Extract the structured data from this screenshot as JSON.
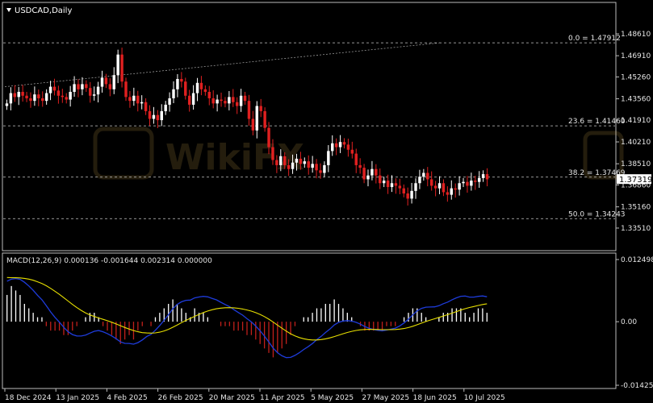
{
  "window": {
    "title": "USDCAD,Daily",
    "menu_icon": "triangle-down-icon",
    "watermark": "WikiFX"
  },
  "colors": {
    "background": "#000000",
    "bull_candle": "#ffffff",
    "bear_candle": "#e02020",
    "grid": "#ffffff",
    "fib_line": "#c8c8c8",
    "macd_pos_hist": "#ffffff",
    "macd_neg_hist": "#c0201b",
    "macd_main": "#1e3cdc",
    "macd_signal": "#e8e000",
    "price_box_bg": "#ffffff"
  },
  "price_axis": {
    "ticks": [
      "1.48610",
      "1.46910",
      "1.45260",
      "1.43560",
      "1.41910",
      "1.40210",
      "1.38510",
      "1.36860",
      "1.35160",
      "1.33510"
    ],
    "current_price": "1.37319"
  },
  "macd_axis": {
    "ticks": [
      "0.012498",
      "0.00",
      "-0.014259"
    ]
  },
  "time_axis": {
    "labels": [
      "18 Dec 2024",
      "13 Jan 2025",
      "4 Feb 2025",
      "26 Feb 2025",
      "20 Mar 2025",
      "11 Apr 2025",
      "5 May 2025",
      "27 May 2025",
      "18 Jun 2025",
      "10 Jul 2025"
    ]
  },
  "fibonacci": [
    {
      "label": "0.0 = 1.47912",
      "level": 1.47912
    },
    {
      "label": "23.6 = 1.41460",
      "level": 1.4146
    },
    {
      "label": "38.2 = 1.37469",
      "level": 1.37469
    },
    {
      "label": "50.0 = 1.34243",
      "level": 1.34243
    }
  ],
  "macd": {
    "label": "MACD(12,26,9) 0.000136 -0.001644 0.002314 0.000000"
  },
  "chart_data": {
    "type": "candlestick",
    "symbol": "USDCAD",
    "timeframe": "Daily",
    "y_range": [
      1.3351,
      1.4861
    ],
    "fib_anchor_levels": [
      1.47912,
      1.4146,
      1.37469,
      1.34243
    ],
    "close_path": [
      1.432,
      1.44,
      1.437,
      1.441,
      1.438,
      1.436,
      1.434,
      1.439,
      1.436,
      1.434,
      1.44,
      1.445,
      1.442,
      1.438,
      1.437,
      1.435,
      1.441,
      1.447,
      1.443,
      1.447,
      1.444,
      1.438,
      1.439,
      1.445,
      1.452,
      1.447,
      1.443,
      1.454,
      1.47,
      1.449,
      1.437,
      1.434,
      1.438,
      1.432,
      1.433,
      1.426,
      1.42,
      1.423,
      1.419,
      1.426,
      1.431,
      1.436,
      1.443,
      1.451,
      1.449,
      1.438,
      1.431,
      1.44,
      1.448,
      1.443,
      1.441,
      1.436,
      1.432,
      1.435,
      1.434,
      1.432,
      1.437,
      1.433,
      1.43,
      1.438,
      1.434,
      1.42,
      1.411,
      1.43,
      1.426,
      1.413,
      1.398,
      1.388,
      1.384,
      1.391,
      1.384,
      1.381,
      1.386,
      1.389,
      1.385,
      1.387,
      1.382,
      1.385,
      1.38,
      1.378,
      1.384,
      1.395,
      1.401,
      1.398,
      1.402,
      1.4,
      1.396,
      1.393,
      1.384,
      1.382,
      1.373,
      1.376,
      1.381,
      1.376,
      1.37,
      1.372,
      1.367,
      1.37,
      1.368,
      1.366,
      1.362,
      1.358,
      1.364,
      1.37,
      1.375,
      1.378,
      1.373,
      1.368,
      1.366,
      1.37,
      1.363,
      1.361,
      1.366,
      1.365,
      1.37,
      1.371,
      1.368,
      1.372,
      1.371,
      1.374,
      1.377,
      1.373
    ],
    "macd_histogram": [
      0.006,
      0.008,
      0.007,
      0.006,
      0.004,
      0.003,
      0.002,
      0.001,
      0.001,
      -0.001,
      -0.002,
      -0.002,
      -0.002,
      -0.003,
      -0.003,
      -0.002,
      -0.001,
      0.0,
      0.001,
      0.002,
      0.002,
      0.001,
      -0.001,
      -0.002,
      -0.003,
      -0.004,
      -0.005,
      -0.004,
      -0.003,
      -0.004,
      -0.002,
      -0.001,
      0.0,
      -0.001,
      0.001,
      0.002,
      0.003,
      0.004,
      0.005,
      0.004,
      0.003,
      0.002,
      0.001,
      0.003,
      0.002,
      0.002,
      0.001,
      0.0,
      0.0,
      -0.001,
      -0.001,
      -0.001,
      -0.002,
      -0.002,
      -0.002,
      -0.003,
      -0.003,
      -0.004,
      -0.005,
      -0.006,
      -0.007,
      -0.008,
      -0.007,
      -0.006,
      -0.005,
      -0.003,
      -0.001,
      0.0,
      0.001,
      0.001,
      0.002,
      0.003,
      0.003,
      0.004,
      0.004,
      0.005,
      0.004,
      0.003,
      0.002,
      0.001,
      0.0,
      -0.001,
      -0.002,
      -0.002,
      -0.002,
      -0.002,
      -0.002,
      -0.001,
      -0.001,
      -0.001,
      0.0,
      0.001,
      0.002,
      0.003,
      0.003,
      0.002,
      0.001,
      0.0,
      0.0,
      0.001,
      0.002,
      0.002,
      0.003,
      0.003,
      0.003,
      0.002,
      0.001,
      0.002,
      0.003,
      0.003,
      0.002
    ],
    "macd_range": [
      -0.014259,
      0.012498
    ]
  }
}
